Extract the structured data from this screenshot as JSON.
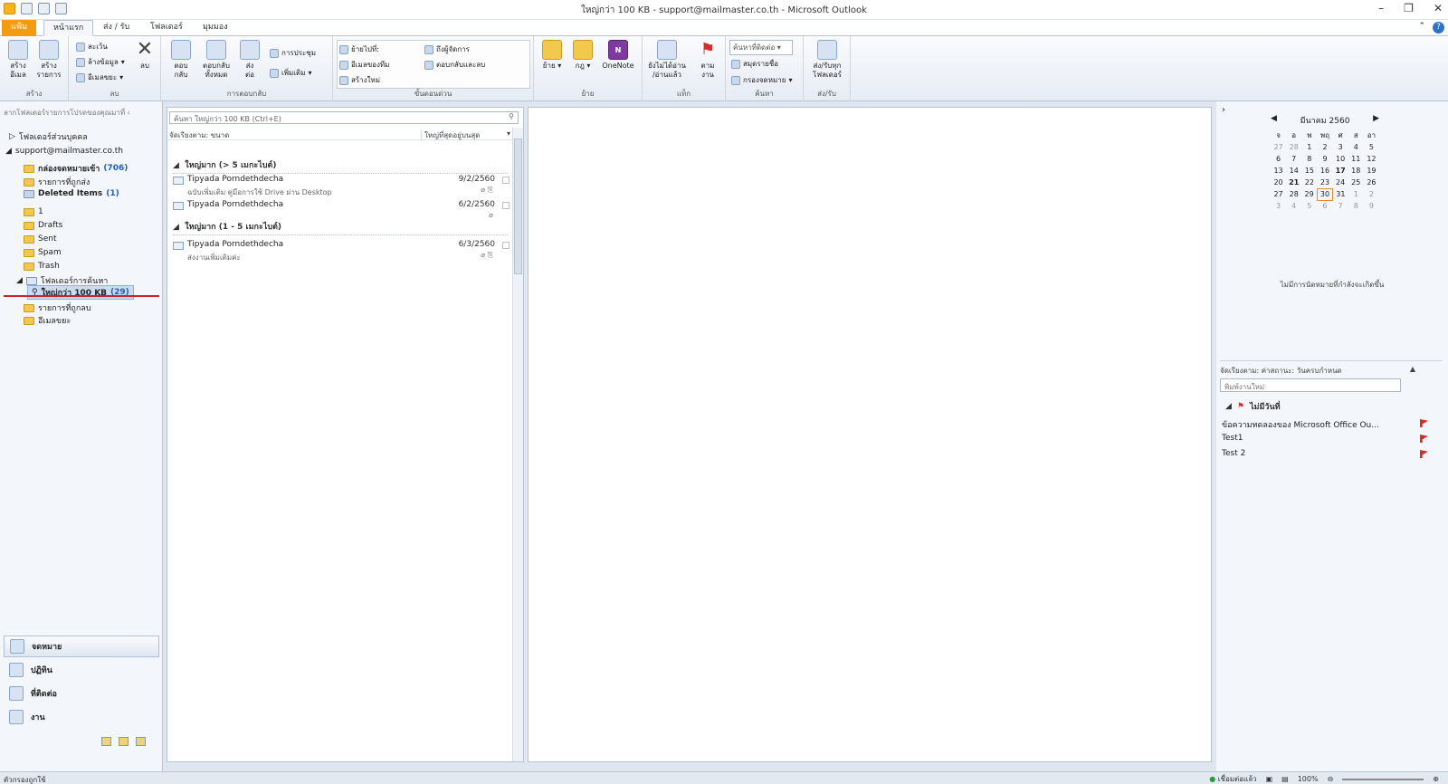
{
  "window": {
    "title": "ใหญ่กว่า 100 KB - support@mailmaster.co.th - Microsoft Outlook",
    "controls": [
      "–",
      "❐",
      "✕"
    ]
  },
  "tabs": {
    "file": "แฟ้ม",
    "home": "หน้าแรก",
    "sendrecv": "ส่ง / รับ",
    "folder": "โฟลเดอร์",
    "view": "มุมมอง"
  },
  "ribbon": {
    "new": {
      "email": "สร้าง\nอีเมล",
      "items": "สร้าง\nรายการ",
      "label": "สร้าง"
    },
    "delete": {
      "ignore": "ละเว้น",
      "cleanup": "ล้างข้อมูล",
      "junk": "อีเมลขยะ",
      "delete": "ลบ",
      "label": "ลบ"
    },
    "respond": {
      "reply": "ตอบ\nกลับ",
      "replyall": "ตอบกลับ\nทั้งหมด",
      "forward": "ส่ง\nต่อ",
      "meeting": "การประชุม",
      "more": "เพิ่มเติม",
      "label": "การตอบกลับ"
    },
    "quicksteps": {
      "moveto": "ย้ายไปที่:",
      "toteam": "อีเมลของทีม",
      "createnew": "สร้างใหม่",
      "tomanager": "ถึงผู้จัดการ",
      "replydelete": "ตอบกลับและลบ",
      "label": "ขั้นตอนด่วน"
    },
    "move": {
      "move": "ย้าย",
      "rules": "กฎ",
      "onenote": "OneNote",
      "label": "ย้าย"
    },
    "tags": {
      "unread": "ยังไม่ได้อ่าน\n/อ่านแล้ว",
      "followup": "ตาม\nงาน",
      "label": "แท็ก"
    },
    "find": {
      "findcontact": "ค้นหาที่ติดต่อ",
      "addressbook": "สมุดรายชื่อ",
      "filter": "กรองจดหมาย",
      "label": "ค้นหา"
    },
    "sendreceive": {
      "all": "ส่ง/รับทุก\nโฟลเดอร์",
      "label": "ส่ง/รับ"
    }
  },
  "nav": {
    "hint": "ลากโฟลเดอร์รายการโปรดของคุณมาที่",
    "personal": "โฟลเดอร์ส่วนบุคคล",
    "account": "support@mailmaster.co.th",
    "inbox": "กล่องจดหมายเข้า",
    "inbox_count": "(706)",
    "sent_items": "รายการที่ถูกส่ง",
    "deleted": "Deleted Items",
    "deleted_count": "(1)",
    "f1": "1",
    "drafts": "Drafts",
    "sent": "Sent",
    "spam": "Spam",
    "trash": "Trash",
    "search_folders": "โฟลเดอร์การค้นหา",
    "larger": "ใหญ่กว่า 100 KB",
    "larger_count": "(29)",
    "deleted_items_th": "รายการที่ถูกลบ",
    "junk": "อีเมลขยะ",
    "buttons": {
      "mail": "จดหมาย",
      "calendar": "ปฏิทิน",
      "contacts": "ที่ติดต่อ",
      "tasks": "งาน"
    }
  },
  "list": {
    "search_placeholder": "ค้นหา ใหญ่กว่า 100 KB (Ctrl+E)",
    "sort_by": "จัดเรียงตาม: ขนาด",
    "sort_order": "ใหญ่ที่สุดอยู่บนสุด",
    "groups": [
      {
        "title": "ใหญ่มาก (> 5 เมกะไบต์)",
        "messages": [
          {
            "from": "Tipyada Porndethdecha",
            "date": "9/2/2560",
            "preview": "ฉบับเพิ่มเติม คู่มือการใช้ Drive ผ่าน Desktop"
          },
          {
            "from": "Tipyada Porndethdecha",
            "date": "6/2/2560",
            "preview": ""
          }
        ]
      },
      {
        "title": "ใหญ่มาก (1 - 5 เมกะไบต์)",
        "messages": [
          {
            "from": "Tipyada Porndethdecha",
            "date": "6/3/2560",
            "preview": "ส่งงานเพิ่มเติมค่ะ"
          }
        ]
      }
    ]
  },
  "calendar": {
    "month": "มีนาคม 2560",
    "weekdays": [
      "จ",
      "อ",
      "พ",
      "พฤ",
      "ศ",
      "ส",
      "อา"
    ],
    "weeks": [
      [
        "27",
        "28",
        "1",
        "2",
        "3",
        "4",
        "5"
      ],
      [
        "6",
        "7",
        "8",
        "9",
        "10",
        "11",
        "12"
      ],
      [
        "13",
        "14",
        "15",
        "16",
        "17",
        "18",
        "19"
      ],
      [
        "20",
        "21",
        "22",
        "23",
        "24",
        "25",
        "26"
      ],
      [
        "27",
        "28",
        "29",
        "30",
        "31",
        "1",
        "2"
      ],
      [
        "3",
        "4",
        "5",
        "6",
        "7",
        "8",
        "9"
      ]
    ],
    "no_appointments": "ไม่มีการนัดหมายที่กำลังจะเกิดขึ้น"
  },
  "todo": {
    "arrange": "จัดเรียงตาม: ค่าสถานะ: วันครบกำหนด",
    "new_task": "พิมพ์งานใหม่",
    "group": "ไม่มีวันที่",
    "tasks": [
      "ข้อความทดลองของ Microsoft Office Ou...",
      "Test1",
      "Test 2"
    ]
  },
  "status": {
    "left": "ตัวกรองถูกใช้",
    "connection": "เชื่อมต่อแล้ว",
    "zoom": "100%"
  },
  "colors": {
    "file_tab": "#f39c12",
    "selection": "#c9dcf3",
    "count": "#1f5fbf",
    "flag": "#d42b2b"
  }
}
